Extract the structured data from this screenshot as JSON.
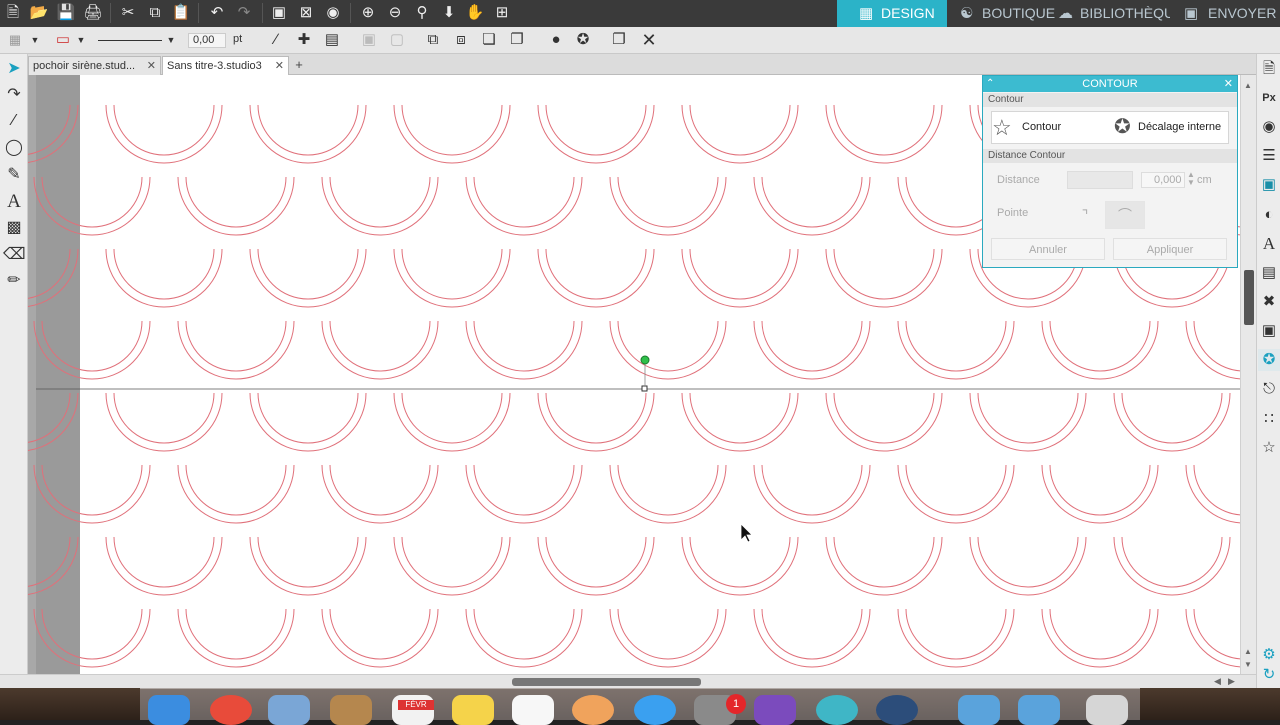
{
  "mode_tabs": [
    {
      "label": "DESIGN",
      "icon": "grid-icon"
    },
    {
      "label": "BOUTIQUE",
      "icon": "store-icon"
    },
    {
      "label": "BIBLIOTHÈQUE",
      "icon": "cloud-icon"
    },
    {
      "label": "ENVOYER",
      "icon": "cutter-icon"
    }
  ],
  "options_bar": {
    "line_weight": "0,00",
    "line_unit": "pt"
  },
  "doc_tabs": [
    {
      "label": "pochoir sirène.stud...",
      "active": false
    },
    {
      "label": "Sans titre-3.studio3",
      "active": true
    }
  ],
  "contour_panel": {
    "title": "CONTOUR",
    "section_contour": "Contour",
    "option_contour": "Contour",
    "option_inner": "Décalage interne",
    "section_distance": "Distance Contour",
    "distance_label": "Distance",
    "distance_value": "0,000",
    "distance_unit": "cm",
    "corner_label": "Pointe",
    "cancel_label": "Annuler",
    "apply_label": "Appliquer"
  },
  "dock": {
    "calendar_month": "FÉVR",
    "notification_count": "1"
  },
  "colors": {
    "accent": "#2bb3c8",
    "cut_line": "#e0707a",
    "toolbar_dark": "#3a3a3a"
  }
}
